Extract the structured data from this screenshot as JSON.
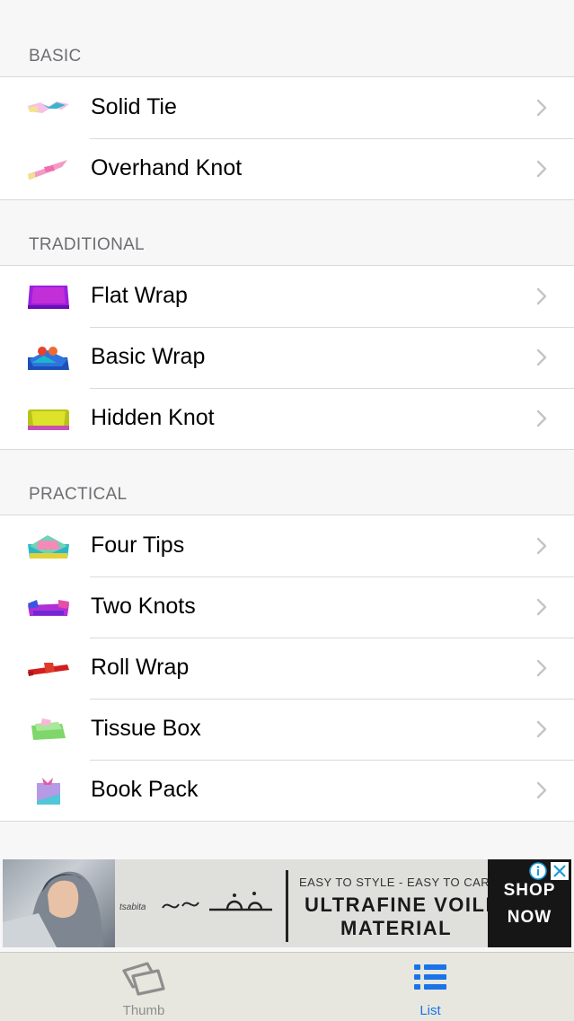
{
  "sections": [
    {
      "header": "BASIC",
      "items": [
        {
          "label": "Solid Tie"
        },
        {
          "label": "Overhand Knot"
        }
      ]
    },
    {
      "header": "TRADITIONAL",
      "items": [
        {
          "label": "Flat Wrap"
        },
        {
          "label": "Basic Wrap"
        },
        {
          "label": "Hidden Knot"
        }
      ]
    },
    {
      "header": "PRACTICAL",
      "items": [
        {
          "label": "Four Tips"
        },
        {
          "label": "Two Knots"
        },
        {
          "label": "Roll Wrap"
        },
        {
          "label": "Tissue Box"
        },
        {
          "label": "Book Pack"
        }
      ]
    }
  ],
  "ad": {
    "line1": "EASY TO STYLE - EASY TO CARE",
    "line2": "ULTRAFINE VOILE",
    "line3": "MATERIAL",
    "brand_small": "tsabita",
    "shop1": "SHOP",
    "shop2": "NOW"
  },
  "tabbar": {
    "tabs": [
      {
        "label": "Thumb",
        "active": false
      },
      {
        "label": "List",
        "active": true
      }
    ],
    "active_color": "#1a73e8",
    "inactive_color": "#8e8e8e"
  }
}
